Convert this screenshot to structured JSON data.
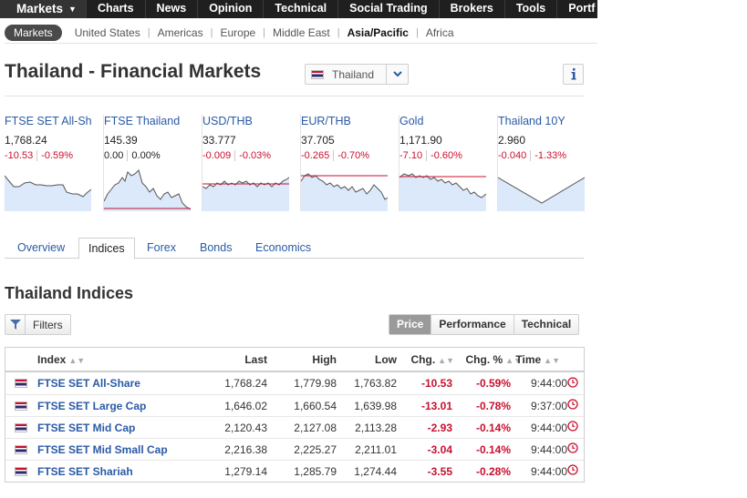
{
  "topnav": {
    "items": [
      {
        "label": "Markets"
      },
      {
        "label": "Charts"
      },
      {
        "label": "News"
      },
      {
        "label": "Opinion"
      },
      {
        "label": "Technical"
      },
      {
        "label": "Social Trading"
      },
      {
        "label": "Brokers"
      },
      {
        "label": "Tools"
      },
      {
        "label": "Portf"
      }
    ]
  },
  "subnav": {
    "pill": "Markets",
    "links": [
      "United States",
      "Americas",
      "Europe",
      "Middle East",
      "Asia/Pacific",
      "Africa"
    ],
    "active": "Asia/Pacific"
  },
  "page": {
    "title": "Thailand - Financial Markets",
    "country": "Thailand",
    "section_title": "Thailand Indices"
  },
  "tiles": [
    {
      "name": "FTSE SET All-Sha",
      "price": "1,768.24",
      "chg": "-10.53",
      "pct": "-0.59%"
    },
    {
      "name": "FTSE Thailand",
      "price": "145.39",
      "chg": "0.00",
      "pct": "0.00%"
    },
    {
      "name": "USD/THB",
      "price": "33.777",
      "chg": "-0.009",
      "pct": "-0.03%"
    },
    {
      "name": "EUR/THB",
      "price": "37.705",
      "chg": "-0.265",
      "pct": "-0.70%"
    },
    {
      "name": "Gold",
      "price": "1,171.90",
      "chg": "-7.10",
      "pct": "-0.60%"
    },
    {
      "name": "Thailand 10Y",
      "price": "2.960",
      "chg": "-0.040",
      "pct": "-1.33%"
    }
  ],
  "tabs": [
    "Overview",
    "Indices",
    "Forex",
    "Bonds",
    "Economics"
  ],
  "active_tab": "Indices",
  "filters": {
    "label": "Filters"
  },
  "view_options": [
    "Price",
    "Performance",
    "Technical"
  ],
  "table": {
    "headers": {
      "index": "Index",
      "last": "Last",
      "high": "High",
      "low": "Low",
      "chg": "Chg.",
      "pct": "Chg. %",
      "time": "Time"
    },
    "rows": [
      {
        "name": "FTSE SET All-Share",
        "last": "1,768.24",
        "high": "1,779.98",
        "low": "1,763.82",
        "chg": "-10.53",
        "pct": "-0.59%",
        "time": "9:44:00"
      },
      {
        "name": "FTSE SET Large Cap",
        "last": "1,646.02",
        "high": "1,660.54",
        "low": "1,639.98",
        "chg": "-13.01",
        "pct": "-0.78%",
        "time": "9:37:00"
      },
      {
        "name": "FTSE SET Mid Cap",
        "last": "2,120.43",
        "high": "2,127.08",
        "low": "2,113.28",
        "chg": "-2.93",
        "pct": "-0.14%",
        "time": "9:44:00"
      },
      {
        "name": "FTSE SET Mid Small Cap",
        "last": "2,216.38",
        "high": "2,225.27",
        "low": "2,211.01",
        "chg": "-3.04",
        "pct": "-0.14%",
        "time": "9:44:00"
      },
      {
        "name": "FTSE SET Shariah",
        "last": "1,279.14",
        "high": "1,285.79",
        "low": "1,274.44",
        "chg": "-3.55",
        "pct": "-0.28%",
        "time": "9:44:00"
      }
    ]
  },
  "colors": {
    "link": "#2a5aa6",
    "negative": "#c8102e",
    "nav_bg": "#1f1f1f",
    "spark_fill": "#dbe9fb"
  }
}
